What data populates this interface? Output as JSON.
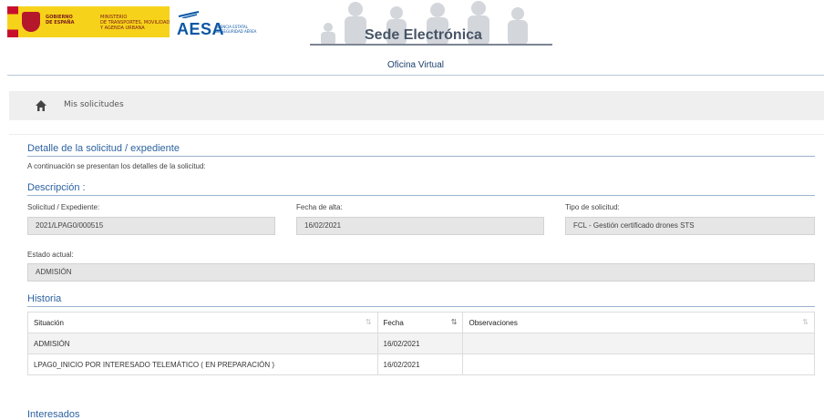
{
  "header": {
    "gov_text_1": "GOBIERNO\nDE ESPAÑA",
    "gov_text_2": "MINISTERIO\nDE TRANSPORTES, MOVILIDAD\nY AGENDA URBANA",
    "aesa_logo": "AESA",
    "aesa_subtitle": "AGENCIA ESTATAL\nDE SEGURIDAD AÉREA",
    "sede_title": "Sede Electrónica",
    "office_title": "Oficina Virtual"
  },
  "breadcrumb": {
    "home_icon": "home-icon",
    "label": "Mis solicitudes"
  },
  "detail": {
    "title": "Detalle de la solicitud / expediente",
    "intro": "A continuación se presentan los detalles de la solicitud:",
    "description_title": "Descripción :",
    "fields": {
      "solicitud_label": "Solicitud / Expediente:",
      "solicitud_value": "2021/LPAG0/000515",
      "fecha_label": "Fecha de alta:",
      "fecha_value": "16/02/2021",
      "tipo_label": "Tipo de solicitud:",
      "tipo_value": "FCL - Gestión certificado drones STS",
      "estado_label": "Estado actual:",
      "estado_value": "ADMISIÓN"
    },
    "history_title": "Historia",
    "history_columns": [
      "Situación",
      "Fecha",
      "Observaciones"
    ],
    "history_rows": [
      {
        "situacion": "ADMISIÓN",
        "fecha": "16/02/2021",
        "observaciones": ""
      },
      {
        "situacion": "LPAG0_INICIO POR INTERESADO TELEMÁTICO ( EN PREPARACIÓN )",
        "fecha": "16/02/2021",
        "observaciones": ""
      }
    ],
    "interesados_title": "Interesados"
  },
  "colors": {
    "section_title": "#2c62a0",
    "gov_yellow": "#f7d21a",
    "aesa_blue": "#0a56a5"
  }
}
